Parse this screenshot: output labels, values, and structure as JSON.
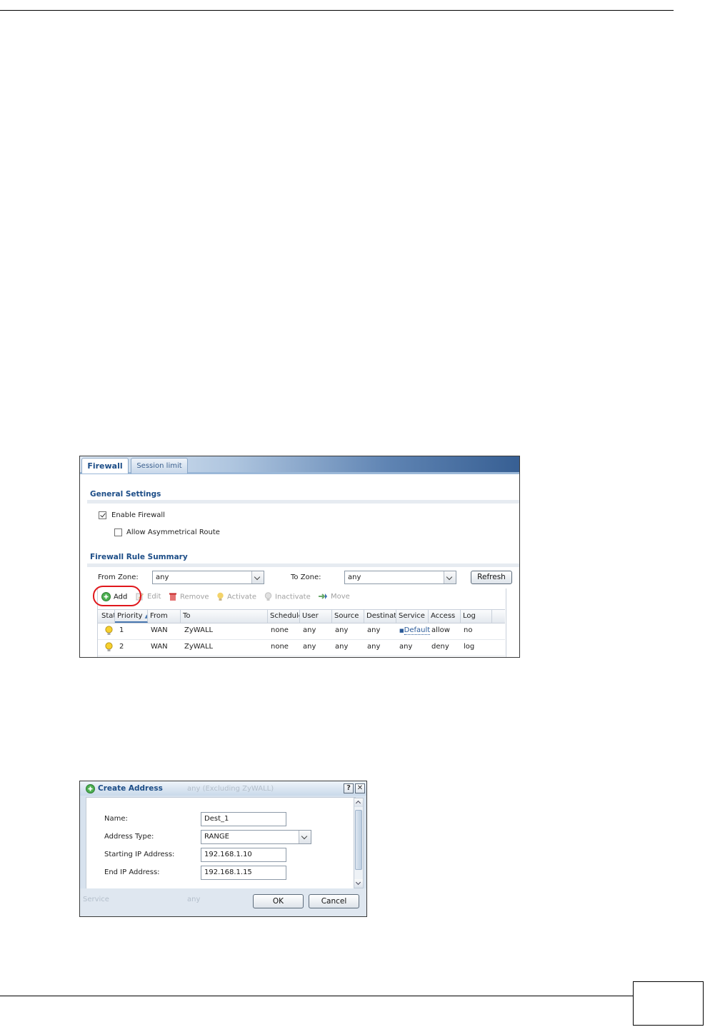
{
  "firewall": {
    "tabs": [
      "Firewall",
      "Session limit"
    ],
    "general_settings_title": "General Settings",
    "enable_firewall_label": "Enable Firewall",
    "enable_firewall_checked": true,
    "allow_asymmetric_label": "Allow Asymmetrical Route",
    "allow_asymmetric_checked": false,
    "rule_summary_title": "Firewall Rule Summary",
    "from_zone_label": "From Zone:",
    "from_zone_value": "any",
    "to_zone_label": "To Zone:",
    "to_zone_value": "any",
    "refresh_label": "Refresh",
    "toolbar": {
      "add": "Add",
      "edit": "Edit",
      "remove": "Remove",
      "activate": "Activate",
      "inactivate": "Inactivate",
      "move": "Move"
    },
    "columns": [
      "Stat",
      "Priority",
      "From",
      "To",
      "Schedule",
      "User",
      "Source",
      "Destinati",
      "Service",
      "Access",
      "Log"
    ],
    "rows": [
      {
        "priority": "1",
        "from": "WAN",
        "to": "ZyWALL",
        "schedule": "none",
        "user": "any",
        "source": "any",
        "destination": "any",
        "service": "Default",
        "access": "allow",
        "log": "no"
      },
      {
        "priority": "2",
        "from": "WAN",
        "to": "ZyWALL",
        "schedule": "none",
        "user": "any",
        "source": "any",
        "destination": "any",
        "service": "any",
        "access": "deny",
        "log": "log"
      }
    ]
  },
  "dialog": {
    "title": "Create Address",
    "help_label": "?",
    "close_label": "✕",
    "behind_text_1": "any (Excluding ZyWALL)",
    "behind_text_2": "Service",
    "behind_text_3": "any",
    "name_label": "Name:",
    "name_value": "Dest_1",
    "type_label": "Address Type:",
    "type_value": "RANGE",
    "start_label": "Starting IP Address:",
    "start_value": "192.168.1.10",
    "end_label": "End IP Address:",
    "end_value": "192.168.1.15",
    "ok_label": "OK",
    "cancel_label": "Cancel"
  }
}
